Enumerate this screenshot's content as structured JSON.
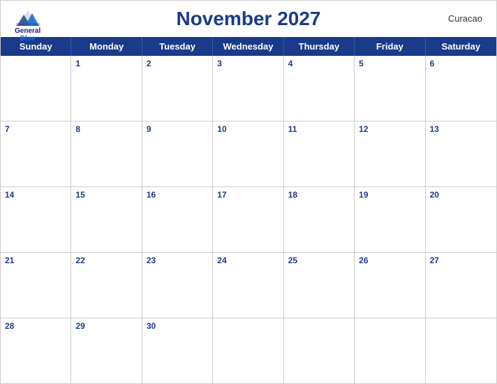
{
  "header": {
    "title": "November 2027",
    "country": "Curacao",
    "logo": {
      "line1": "General",
      "line2": "Blue"
    }
  },
  "days_of_week": [
    "Sunday",
    "Monday",
    "Tuesday",
    "Wednesday",
    "Thursday",
    "Friday",
    "Saturday"
  ],
  "weeks": [
    [
      {
        "num": "",
        "empty": true
      },
      {
        "num": "1"
      },
      {
        "num": "2"
      },
      {
        "num": "3"
      },
      {
        "num": "4"
      },
      {
        "num": "5"
      },
      {
        "num": "6"
      }
    ],
    [
      {
        "num": "7"
      },
      {
        "num": "8"
      },
      {
        "num": "9"
      },
      {
        "num": "10"
      },
      {
        "num": "11"
      },
      {
        "num": "12"
      },
      {
        "num": "13"
      }
    ],
    [
      {
        "num": "14"
      },
      {
        "num": "15"
      },
      {
        "num": "16"
      },
      {
        "num": "17"
      },
      {
        "num": "18"
      },
      {
        "num": "19"
      },
      {
        "num": "20"
      }
    ],
    [
      {
        "num": "21"
      },
      {
        "num": "22"
      },
      {
        "num": "23"
      },
      {
        "num": "24"
      },
      {
        "num": "25"
      },
      {
        "num": "26"
      },
      {
        "num": "27"
      }
    ],
    [
      {
        "num": "28"
      },
      {
        "num": "29"
      },
      {
        "num": "30"
      },
      {
        "num": "",
        "empty": true
      },
      {
        "num": "",
        "empty": true
      },
      {
        "num": "",
        "empty": true
      },
      {
        "num": "",
        "empty": true
      }
    ]
  ],
  "colors": {
    "header_bg": "#1a3a8a",
    "header_text": "#ffffff",
    "day_num": "#1a3a8a",
    "border": "#cccccc",
    "cell_bg": "#ffffff"
  }
}
